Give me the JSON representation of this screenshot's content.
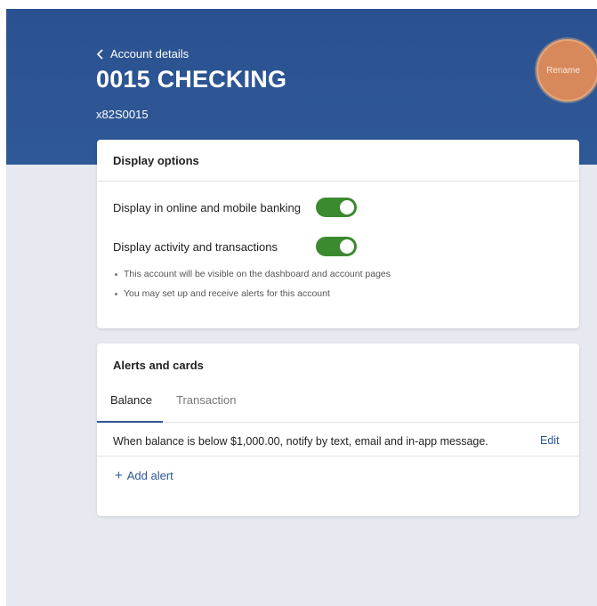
{
  "header": {
    "back_label": "Account details",
    "title": "0015 CHECKING",
    "account_number": "x82S0015",
    "rename_label": "Rename"
  },
  "display_options": {
    "title": "Display options",
    "options": [
      {
        "label": "Display in online and mobile banking",
        "enabled": true
      },
      {
        "label": "Display activity and transactions",
        "enabled": true
      }
    ],
    "notes": [
      "This account will be visible on the dashboard and account pages",
      "You may set up and receive alerts for this account"
    ]
  },
  "alerts": {
    "title": "Alerts and cards",
    "tabs": [
      {
        "label": "Balance",
        "active": true
      },
      {
        "label": "Transaction",
        "active": false
      }
    ],
    "alert_text": "When balance is below $1,000.00, notify by text, email and in-app message.",
    "edit_label": "Edit",
    "add_label": "Add alert"
  },
  "colors": {
    "header_bg": "#2d5593",
    "toggle_on": "#3c8a2f",
    "rename_bg": "#d7895c",
    "link": "#2d5593",
    "page_bg": "#e6e9ef"
  },
  "icons": {
    "back": "chevron-left-icon",
    "add": "plus-icon"
  }
}
